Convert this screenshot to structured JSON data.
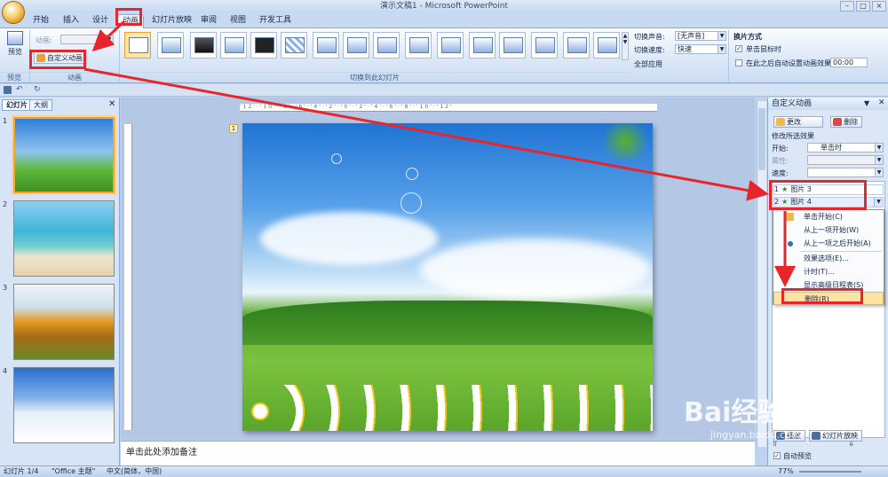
{
  "window": {
    "title": "演示文稿1 - Microsoft PowerPoint"
  },
  "tabs": [
    "开始",
    "插入",
    "设计",
    "动画",
    "幻灯片放映",
    "审阅",
    "视图",
    "开发工具"
  ],
  "ribbon": {
    "preview_group": {
      "button": "预览",
      "label": "预览"
    },
    "animation_group": {
      "animate_label": "动画:",
      "custom_button": "自定义动画",
      "label": "动画"
    },
    "transition_group": {
      "label": "切换到此幻灯片",
      "sound_label": "切换声音:",
      "sound_value": "[无声音]",
      "speed_label": "切换速度:",
      "speed_value": "快速",
      "apply_all": "全部应用",
      "advance_title": "换片方式",
      "on_click": "单击鼠标时",
      "auto_after": "在此之后自动设置动画效果:",
      "auto_time": "00:00"
    }
  },
  "left_pane": {
    "tabs": [
      "幻灯片",
      "大纲"
    ],
    "slide_numbers": [
      "1",
      "2",
      "3",
      "4"
    ]
  },
  "slide": {
    "number_marker": "1"
  },
  "notes": {
    "placeholder": "单击此处添加备注"
  },
  "task_pane": {
    "title": "自定义动画",
    "change_btn": "更改",
    "delete_btn": "删除",
    "modify_label": "修改所选效果",
    "start_label": "开始:",
    "start_value": "单击时",
    "property_label": "属性:",
    "speed_label": "速度:",
    "items": [
      {
        "num": "1",
        "name": "图片 3"
      },
      {
        "num": "2",
        "name": "图片 4"
      }
    ],
    "play_btn": "播放",
    "slideshow_btn": "幻灯片放映",
    "autopreview": "自动预览"
  },
  "context_menu": [
    "单击开始(C)",
    "从上一项开始(W)",
    "从上一项之后开始(A)",
    "效果选项(E)...",
    "计时(T)...",
    "显示高级日程表(S)",
    "删除(R)"
  ],
  "statusbar": {
    "slide": "幻灯片 1/4",
    "theme": "\"Office 主题\"",
    "lang": "中文(简体，中国)",
    "zoom": "77%"
  },
  "watermark": {
    "brand": "Bai经验",
    "url": "jingyan.baidu.com"
  }
}
